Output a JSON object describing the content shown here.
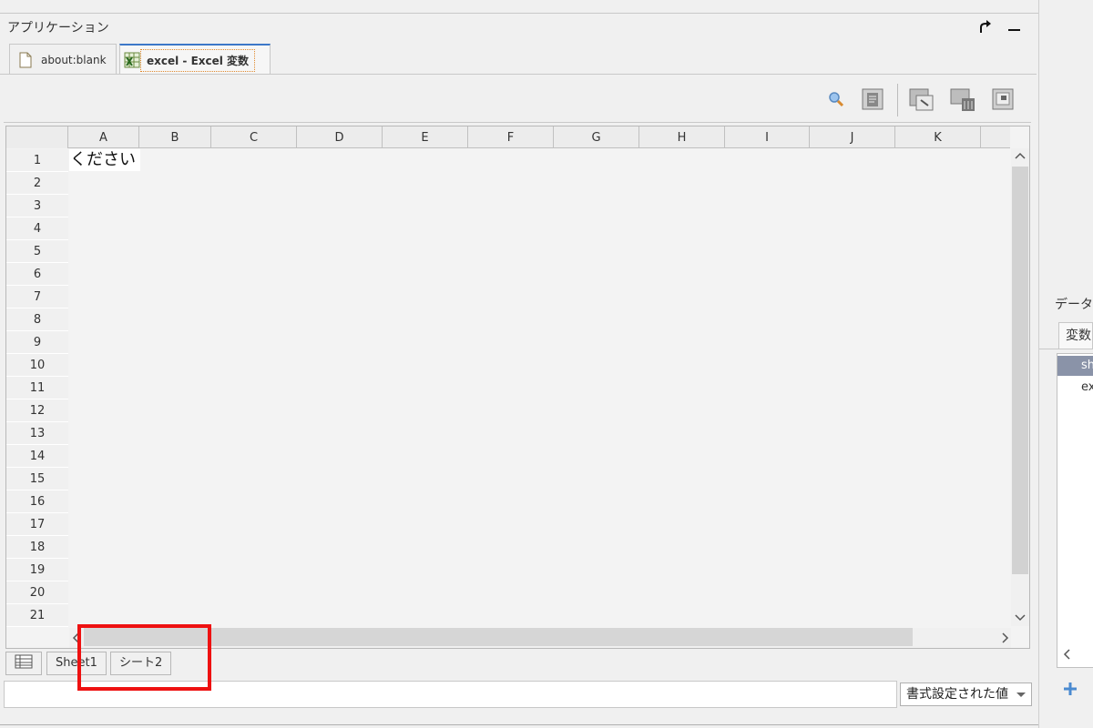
{
  "app": {
    "title": "アプリケーション"
  },
  "tabs": [
    {
      "label": "about:blank"
    },
    {
      "label": "excel - Excel 変数"
    }
  ],
  "grid": {
    "columns": [
      "A",
      "B",
      "C",
      "D",
      "E",
      "F",
      "G",
      "H",
      "I",
      "J",
      "K"
    ],
    "rows": [
      "1",
      "2",
      "3",
      "4",
      "5",
      "6",
      "7",
      "8",
      "9",
      "10",
      "11",
      "12",
      "13",
      "14",
      "15",
      "16",
      "17",
      "18",
      "19",
      "20",
      "21"
    ],
    "cell_a1": "ください"
  },
  "sheets": [
    {
      "label": "Sheet1"
    },
    {
      "label": "シート2"
    }
  ],
  "formula": {
    "value": ""
  },
  "format_select": {
    "selected": "書式設定された値"
  },
  "right_panel": {
    "title": "データ",
    "tab": "変数",
    "items": [
      "sh",
      "ex"
    ]
  },
  "colors": {
    "accent": "#3c78c8",
    "highlight": "#ee1111",
    "selected_row": "#8a93a8"
  }
}
